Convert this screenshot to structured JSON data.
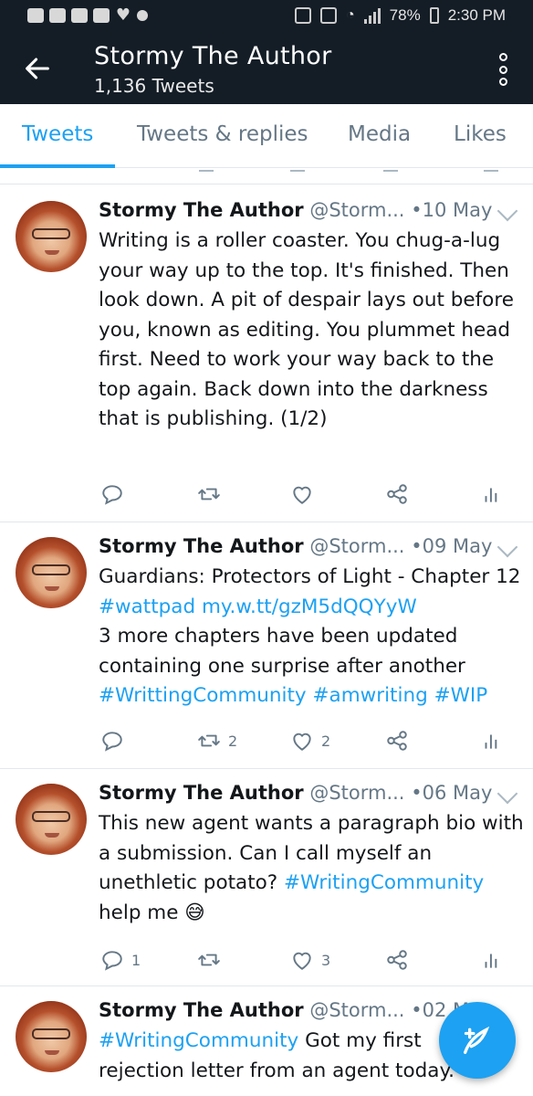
{
  "status_bar": {
    "battery": "78%",
    "time": "2:30 PM"
  },
  "header": {
    "title": "Stormy The Author",
    "subtitle": "1,136 Tweets"
  },
  "tabs": [
    {
      "label": "Tweets",
      "active": true
    },
    {
      "label": "Tweets & replies",
      "active": false
    },
    {
      "label": "Media",
      "active": false
    },
    {
      "label": "Likes",
      "active": false
    }
  ],
  "tweets": [
    {
      "name": "Stormy The Author",
      "handle": "@Storm...",
      "date": "10 May",
      "text": "Writing is a roller coaster. You chug-a-lug your way up to the top. It's finished. Then look down. A pit of despair lays out before you, known as editing. You plummet head first. Need to work your way back to the top again. Back down into the darkness that is publishing. (1/2)",
      "replies": "",
      "retweets": "",
      "likes": ""
    },
    {
      "name": "Stormy The Author",
      "handle": "@Storm...",
      "date": "09 May",
      "text_parts": {
        "line1": "Guardians: Protectors of Light - Chapter 12 ",
        "hashtag1": "#wattpad",
        "link": "my.w.tt/gzM5dQQYyW",
        "line2": "3 more chapters have been updated containing one surprise after another ",
        "hashtag2": "#WrittingCommunity",
        "hashtag3": "#amwriting",
        "hashtag4": "#WIP"
      },
      "replies": "",
      "retweets": "2",
      "likes": "2"
    },
    {
      "name": "Stormy The Author",
      "handle": "@Storm...",
      "date": "06 May",
      "text_parts": {
        "line1": "This new agent wants a paragraph bio with a submission. Can I call myself an unethletic potato? ",
        "hashtag1": "#WritingCommunity",
        "line2": "help me ",
        "emoji": "😅"
      },
      "replies": "1",
      "retweets": "",
      "likes": "3"
    },
    {
      "name": "Stormy The Author",
      "handle": "@Storm...",
      "date": "02 M",
      "text_parts": {
        "hashtag1": "#WritingCommunity",
        "line1": " Got my first rejection letter from an agent today."
      }
    }
  ],
  "colors": {
    "accent": "#1da1f2",
    "header_bg": "#141d26",
    "muted": "#657786"
  },
  "icons": {
    "fab": "compose-tweet-icon",
    "reply": "reply-icon",
    "retweet": "retweet-icon",
    "like": "heart-icon",
    "share": "share-icon",
    "analytics": "analytics-icon"
  }
}
